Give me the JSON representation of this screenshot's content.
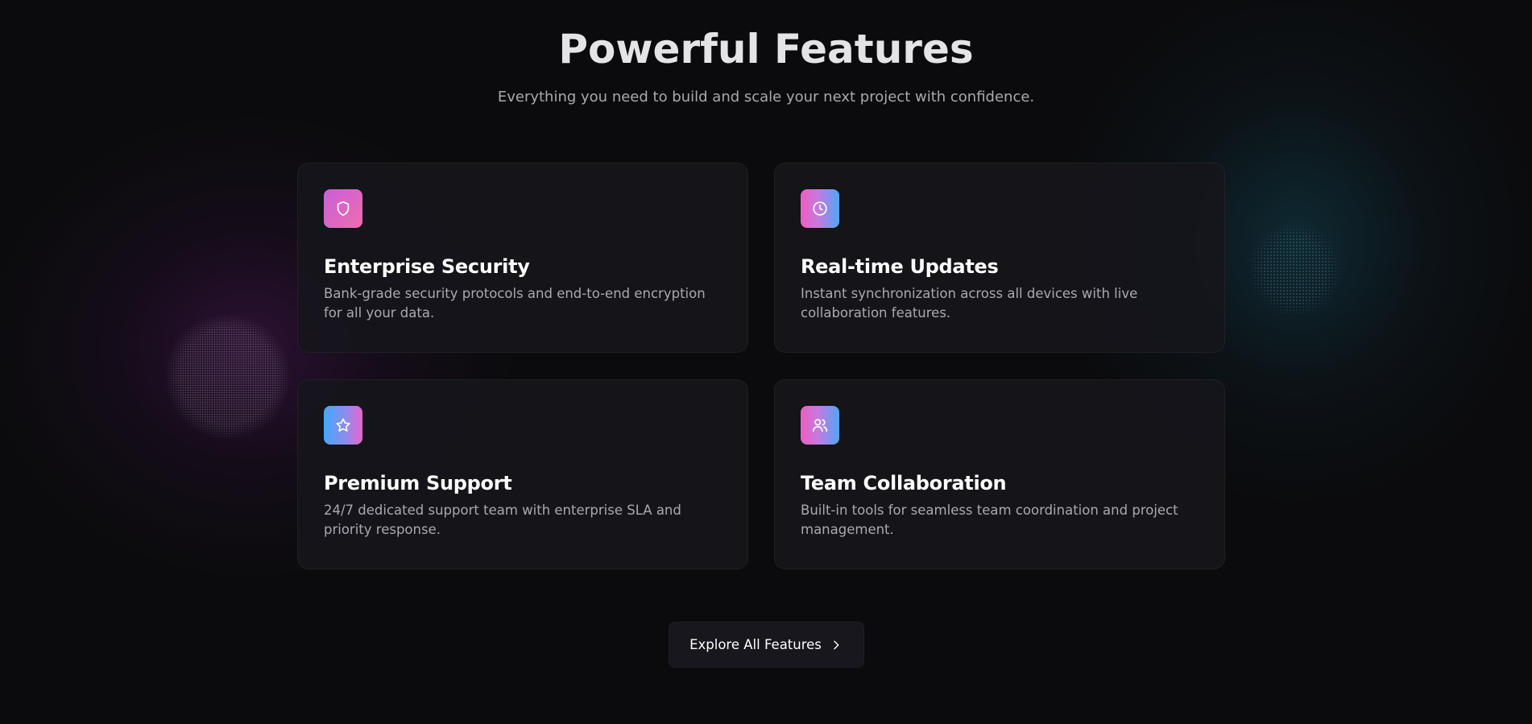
{
  "header": {
    "title": "Powerful Features",
    "subtitle": "Everything you need to build and scale your next project with confidence."
  },
  "features": [
    {
      "icon": "shield-icon",
      "title": "Enterprise Security",
      "description": "Bank-grade security protocols and end-to-end encryption for all your data."
    },
    {
      "icon": "clock-icon",
      "title": "Real-time Updates",
      "description": "Instant synchronization across all devices with live collaboration features."
    },
    {
      "icon": "star-icon",
      "title": "Premium Support",
      "description": "24/7 dedicated support team with enterprise SLA and priority response."
    },
    {
      "icon": "users-icon",
      "title": "Team Collaboration",
      "description": "Built-in tools for seamless team coordination and project management."
    }
  ],
  "cta": {
    "label": "Explore All Features",
    "icon": "chevron-right-icon"
  },
  "colors": {
    "background": "#0b0b0d",
    "card_background": "#16161b",
    "title_text": "#e4e4e6",
    "body_text": "#a9a9b0",
    "accent_pink": "#f06cb0",
    "accent_purple": "#c85fd8",
    "accent_blue": "#4fa6f5",
    "glow_left": "#781e8c",
    "glow_right": "#145a6e"
  }
}
